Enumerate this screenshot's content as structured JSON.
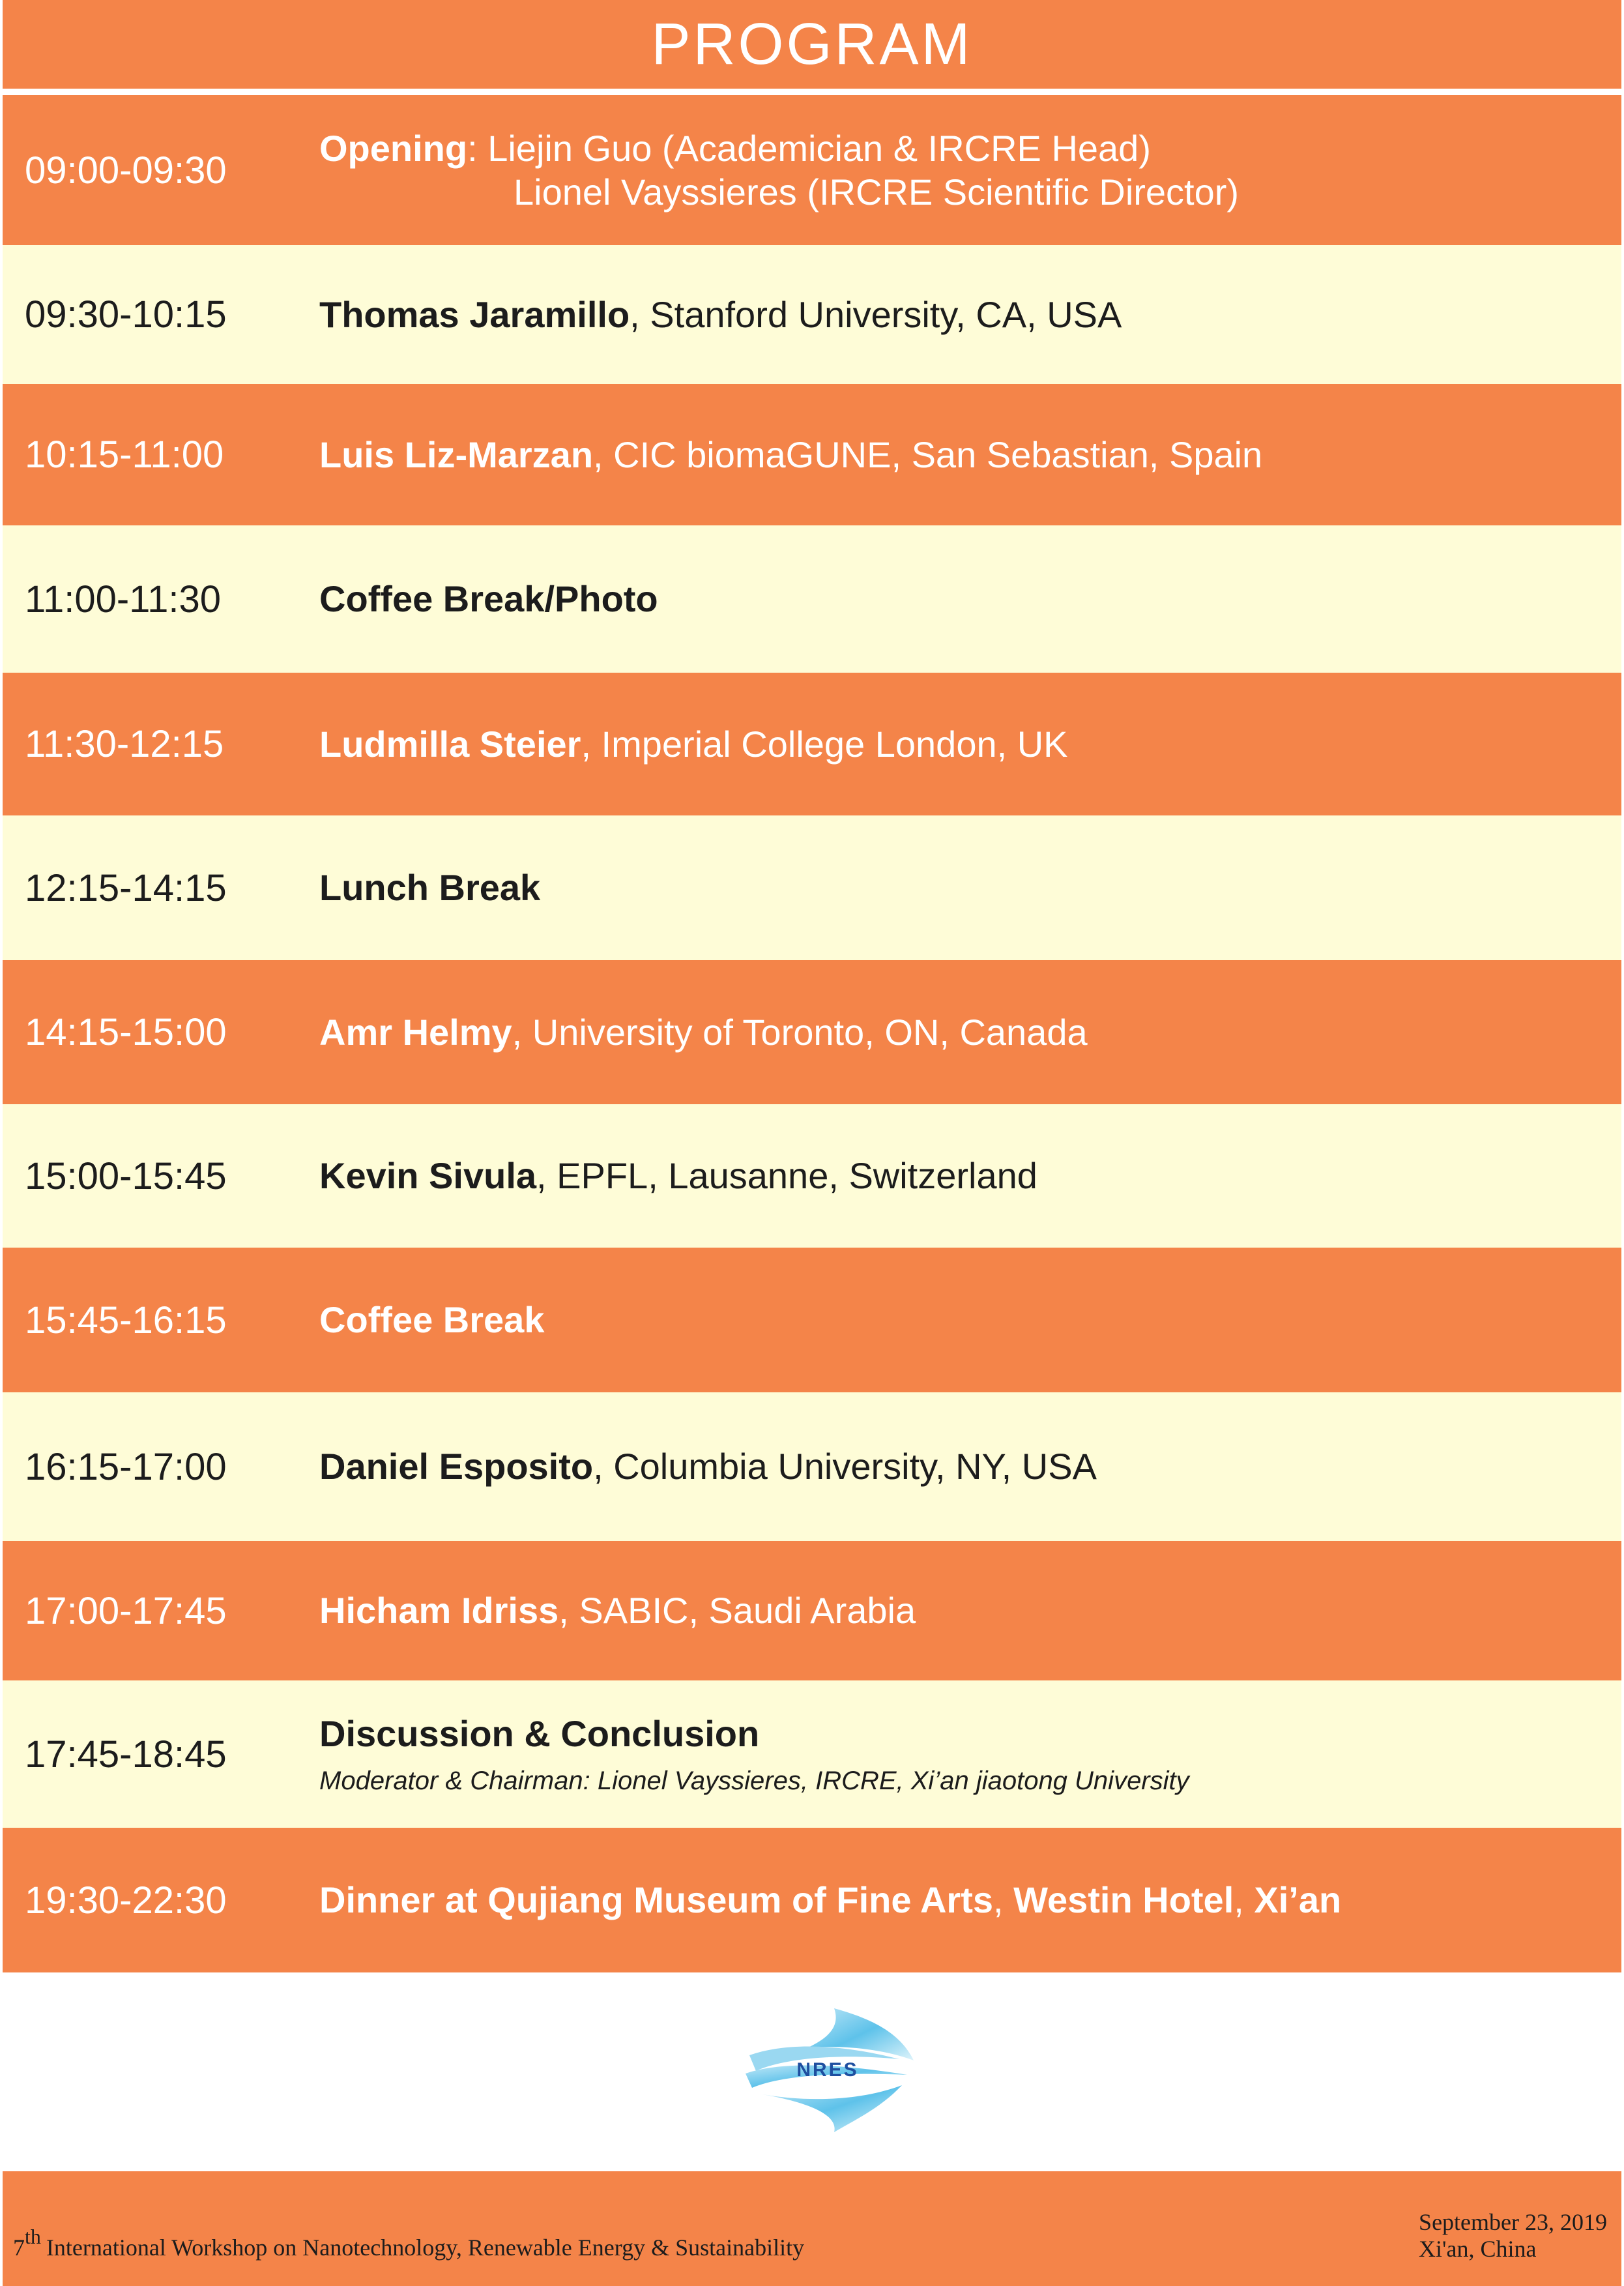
{
  "header": {
    "title": "PROGRAM"
  },
  "rows": [
    {
      "time": "09:00-09:30",
      "bold": "Opening",
      "text": ": Liejin Guo (Academician & IRCRE Head)",
      "line2": "Lionel Vayssieres (IRCRE Scientific Director)"
    },
    {
      "time": "09:30-10:15",
      "bold": "Thomas Jaramillo",
      "text": ", Stanford University, CA, USA"
    },
    {
      "time": "10:15-11:00",
      "bold": "Luis Liz-Marzan",
      "text": ", CIC biomaGUNE, San Sebastian, Spain"
    },
    {
      "time": "11:00-11:30",
      "bold": "Coffee Break/Photo",
      "text": ""
    },
    {
      "time": "11:30-12:15",
      "bold": "Ludmilla Steier",
      "text": ", Imperial College London, UK"
    },
    {
      "time": "12:15-14:15",
      "bold": "Lunch Break",
      "text": ""
    },
    {
      "time": "14:15-15:00",
      "bold": "Amr Helmy",
      "text": ", University of Toronto, ON, Canada"
    },
    {
      "time": "15:00-15:45",
      "bold": "Kevin Sivula",
      "text": ", EPFL, Lausanne, Switzerland"
    },
    {
      "time": "15:45-16:15",
      "bold": "Coffee Break",
      "text": ""
    },
    {
      "time": "16:15-17:00",
      "bold": "Daniel Esposito",
      "text": ", Columbia University, NY, USA"
    },
    {
      "time": "17:00-17:45",
      "bold": "Hicham Idriss",
      "text": ", SABIC, Saudi Arabia"
    },
    {
      "time": "17:45-18:45",
      "bold": "Discussion & Conclusion",
      "text": "",
      "sub": "Moderator & Chairman: Lionel Vayssieres, IRCRE, Xi’an jiaotong University"
    },
    {
      "time": "19:30-22:30",
      "bold": "Dinner at Qujiang Museum of Fine Arts",
      "text": ", ",
      "bold2": "Westin Hotel",
      "text2": ", ",
      "bold3": "Xi’an"
    }
  ],
  "logo": {
    "text": "NRES"
  },
  "footer": {
    "ordinal_num": "7",
    "ordinal_suffix": "th",
    "workshop": "International Workshop on  Nanotechnology, Renewable Energy & Sustainability",
    "date": "September 23, 2019",
    "location": "Xi'an, China"
  },
  "colors": {
    "orange": "#f48449",
    "cream": "#fefcd7",
    "dark_text": "#1c1c1c"
  }
}
